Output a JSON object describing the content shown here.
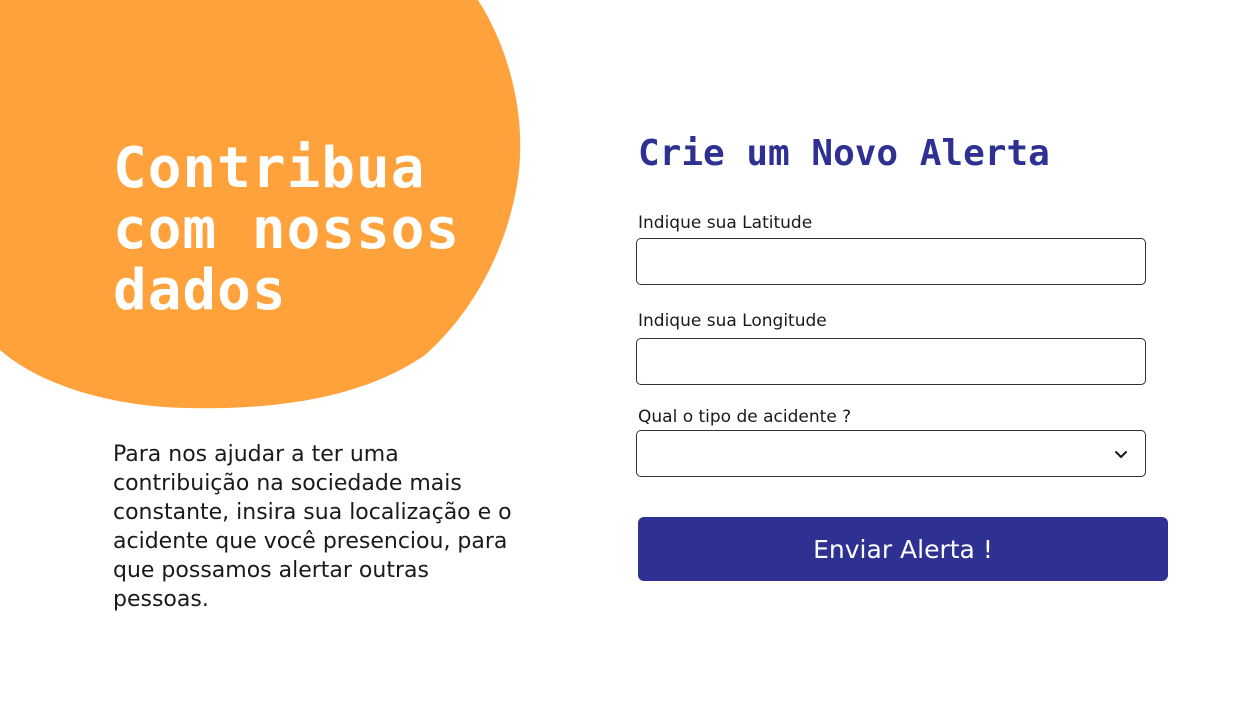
{
  "hero": {
    "title_lines": [
      "Contribua",
      "com nossos",
      "dados"
    ],
    "description_lines": [
      "Para nos ajudar a ter uma",
      "contribuição na sociedade mais",
      "constante, insira sua localização e o",
      "acidente que você presenciou, para",
      "que possamos alertar outras",
      "pessoas."
    ]
  },
  "form": {
    "title": "Crie um Novo Alerta",
    "latitude": {
      "label": "Indique sua Latitude",
      "value": ""
    },
    "longitude": {
      "label": "Indique sua Longitude",
      "value": ""
    },
    "accident_type": {
      "label": "Qual o tipo de acidente ?",
      "selected": ""
    },
    "submit_label": "Enviar Alerta !"
  },
  "colors": {
    "blob": "#ffa23c",
    "primary": "#2e3192",
    "text": "#1a1a1a"
  },
  "icons": {
    "select_indicator": "chevron-down-icon"
  }
}
